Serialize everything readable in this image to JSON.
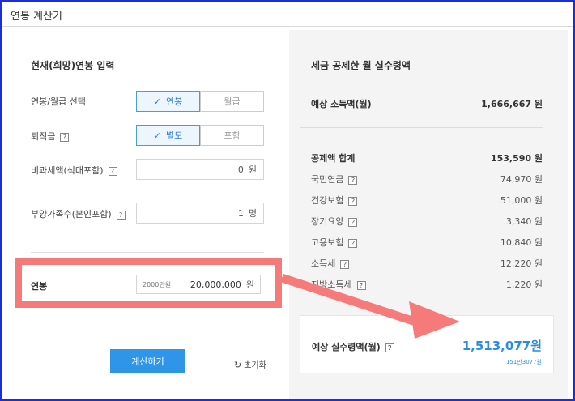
{
  "window": {
    "title": "연봉 계산기"
  },
  "input": {
    "section_title": "현재(희망)연봉 입력",
    "salary_type": {
      "label": "연봉/월급 선택",
      "options": [
        "연봉",
        "월급"
      ],
      "selected": "연봉"
    },
    "severance": {
      "label": "퇴직금",
      "options": [
        "별도",
        "포함"
      ],
      "selected": "별도"
    },
    "non_taxable": {
      "label": "비과세액(식대포함)",
      "value": "0",
      "unit": "원"
    },
    "dependents": {
      "label": "부양가족수(본인포함)",
      "value": "1",
      "unit": "명"
    },
    "annual_salary": {
      "label": "연봉",
      "hint": "2000만원",
      "value": "20,000,000",
      "unit": "원"
    },
    "calculate_label": "계산하기",
    "reset_label": "초기화"
  },
  "result": {
    "section_title": "세금 공제한 월 실수령액",
    "expected_income": {
      "label": "예상 소득액(월)",
      "value": "1,666,667 원"
    },
    "deduction_total": {
      "label": "공제액 합계",
      "value": "153,590 원"
    },
    "deductions": [
      {
        "label": "국민연금",
        "value": "74,970 원"
      },
      {
        "label": "건강보험",
        "value": "51,000 원"
      },
      {
        "label": "장기요양",
        "value": "3,340 원"
      },
      {
        "label": "고용보험",
        "value": "10,840 원"
      },
      {
        "label": "소득세",
        "value": "12,220 원"
      },
      {
        "label": "지방소득세",
        "value": "1,220 원"
      }
    ],
    "net_pay": {
      "label": "예상 실수령액(월)",
      "value": "1,513,077원",
      "sub": "151만3077원"
    }
  },
  "colors": {
    "accent": "#2e95e9",
    "highlight": "#f57b7b",
    "frame": "#1a2fd8"
  },
  "icons": {
    "check": "check-icon",
    "help": "help-icon",
    "reset": "refresh-icon",
    "annotation": "arrow-annotation"
  }
}
